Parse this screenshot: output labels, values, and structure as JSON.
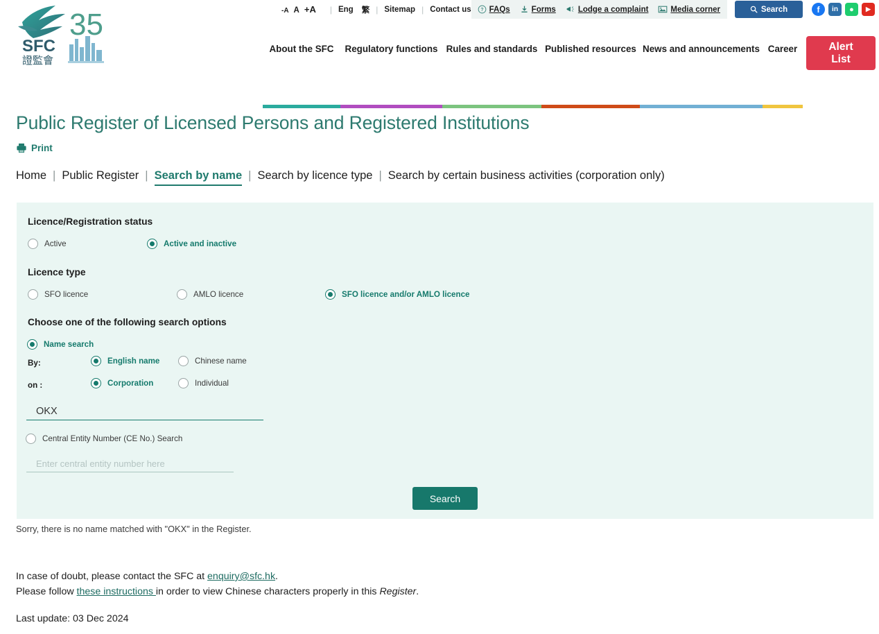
{
  "topbar": {
    "font_size_labels": [
      "-A",
      "A",
      "+A"
    ],
    "lang_en": "Eng",
    "lang_zh": "繁",
    "sitemap": "Sitemap",
    "contact": "Contact us",
    "faqs": "FAQs",
    "forms": "Forms",
    "complaint": "Lodge a complaint",
    "media": "Media corner",
    "search_button": "Search",
    "search_icon": "search-icon",
    "faq_icon": "question-circle-icon",
    "forms_icon": "download-icon",
    "complaint_icon": "megaphone-icon",
    "media_icon": "image-icon",
    "social": [
      {
        "name": "facebook-icon",
        "glyph": "f",
        "color": "#1877f2"
      },
      {
        "name": "linkedin-icon",
        "glyph": "in",
        "color": "#2f6fa8"
      },
      {
        "name": "wechat-icon",
        "glyph": "●",
        "color": "#1ecd6e"
      },
      {
        "name": "youtube-icon",
        "glyph": "▶",
        "color": "#e02a20"
      }
    ]
  },
  "logo": {
    "text_sfc": "SFC",
    "text_zh": "證監會",
    "anniversary": "35",
    "alt": "sfc-35-logo"
  },
  "mainnav": {
    "items": [
      {
        "label": "About the SFC",
        "color": "#2bab9e",
        "width": 112
      },
      {
        "label": "Regulatory functions",
        "color": "#b14dc0",
        "width": 147
      },
      {
        "label": "Rules and standards",
        "color": "#7cc47f",
        "width": 143
      },
      {
        "label": "Published resources",
        "color": "#cf4b18",
        "width": 142
      },
      {
        "label": "News and announcements",
        "color": "#72b0d4",
        "width": 177
      },
      {
        "label": "Career",
        "color": "#f0c53f",
        "width": 58
      }
    ],
    "alert_list_line1": "Alert",
    "alert_list_line2": "List"
  },
  "page": {
    "title": "Public Register of Licensed Persons and Registered Institutions",
    "print_label": "Print",
    "print_icon": "printer-icon"
  },
  "breadcrumb": {
    "items": [
      {
        "label": "Home",
        "active": false
      },
      {
        "label": "Public Register",
        "active": false
      },
      {
        "label": "Search by name",
        "active": true
      },
      {
        "label": "Search by licence type",
        "active": false
      },
      {
        "label": "Search by certain business activities (corporation only)",
        "active": false
      }
    ],
    "separator": "|"
  },
  "form": {
    "status_title": "Licence/Registration status",
    "status_options": [
      {
        "label": "Active",
        "checked": false
      },
      {
        "label": "Active and inactive",
        "checked": true
      }
    ],
    "licence_title": "Licence type",
    "licence_options": [
      {
        "label": "SFO licence",
        "checked": false
      },
      {
        "label": "AMLO licence",
        "checked": false
      },
      {
        "label": "SFO licence and/or AMLO licence",
        "checked": true
      }
    ],
    "options_title": "Choose one of the following search options",
    "name_search": {
      "label": "Name search",
      "checked": true
    },
    "by_label": "By:",
    "by_options": [
      {
        "label": "English name",
        "checked": true
      },
      {
        "label": "Chinese name",
        "checked": false
      }
    ],
    "on_label": "on :",
    "on_options": [
      {
        "label": "Corporation",
        "checked": true
      },
      {
        "label": "Individual",
        "checked": false
      }
    ],
    "name_input_value": "OKX",
    "name_input_placeholder": "",
    "ce_search": {
      "label": "Central Entity Number (CE No.) Search",
      "checked": false
    },
    "ce_input_value": "",
    "ce_input_placeholder": "Enter central entity number here",
    "submit_label": "Search"
  },
  "result": {
    "message": "Sorry, there is no name matched with \"OKX\" in the Register."
  },
  "footer": {
    "line1_pre": "In case of doubt, please contact the SFC at ",
    "line1_link": "enquiry@sfc.hk",
    "line1_post": ".",
    "line2_pre": "Please follow ",
    "line2_link": "these instructions ",
    "line2_mid": "in order to view Chinese characters properly in this ",
    "line2_em": "Register",
    "line2_post": ".",
    "last_update": "Last update: 03 Dec 2024"
  },
  "colors": {
    "brand_teal": "#1f7a6d",
    "panel_bg": "#eaf6f3",
    "alert_red": "#e03a4e",
    "top_search_blue": "#2a6099"
  }
}
